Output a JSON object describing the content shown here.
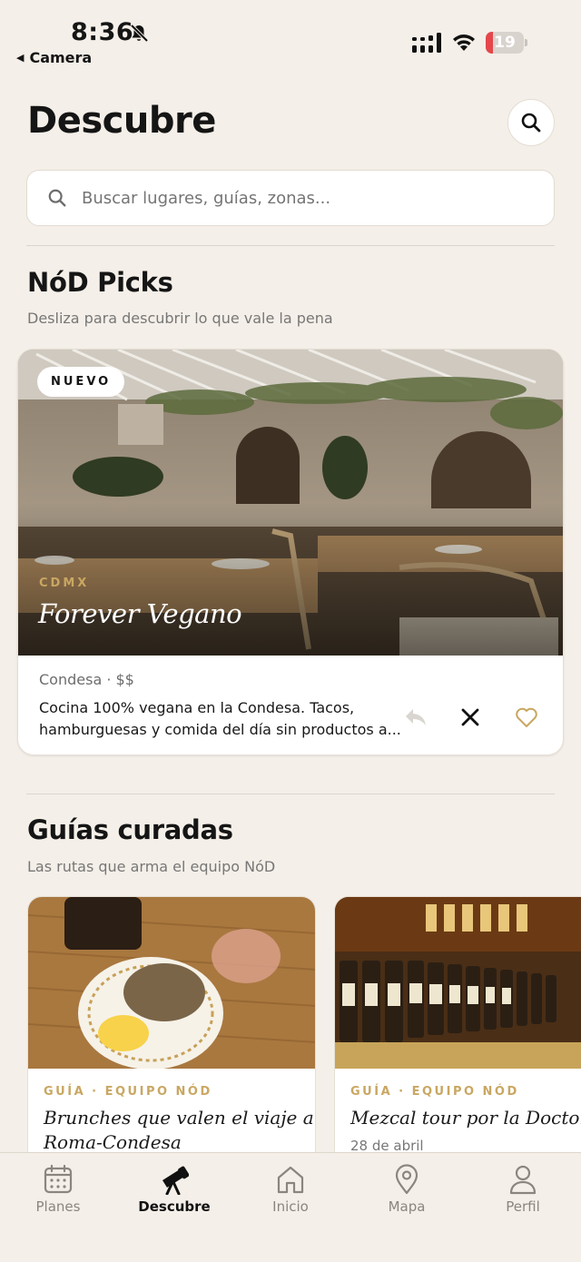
{
  "status": {
    "time": "8:36",
    "back_app": "Camera",
    "battery": "19",
    "battery_level": 0.19
  },
  "header": {
    "title": "Descubre"
  },
  "search": {
    "placeholder": "Buscar lugares, guías, zonas..."
  },
  "picks": {
    "title": "NóD Picks",
    "subtitle": "Desliza para descubrir lo que vale la pena",
    "card": {
      "badge": "NUEVO",
      "city": "CDMX",
      "name": "Forever Vegano",
      "meta": "Condesa · $$",
      "desc_line1": "Cocina 100% vegana en la Condesa. Tacos,",
      "desc_line2": "hamburguesas y comida del día sin productos a..."
    }
  },
  "guides": {
    "title": "Guías curadas",
    "subtitle": "Las rutas que arma el equipo NóD",
    "items": [
      {
        "kicker": "GUÍA · EQUIPO NÓD",
        "title_line1": "Brunches que valen el viaje a",
        "title_line2": "Roma-Condesa",
        "date": ""
      },
      {
        "kicker": "GUÍA · EQUIPO NÓD",
        "title_line1": "Mezcal tour por la Doctores",
        "title_line2": "",
        "date": "28 de abril"
      }
    ]
  },
  "tabs": [
    {
      "label": "Planes",
      "icon": "calendar-icon"
    },
    {
      "label": "Descubre",
      "icon": "telescope-icon",
      "active": true
    },
    {
      "label": "Inicio",
      "icon": "home-icon"
    },
    {
      "label": "Mapa",
      "icon": "map-pin-icon"
    },
    {
      "label": "Perfil",
      "icon": "person-icon"
    }
  ],
  "colors": {
    "background": "#f4efe8",
    "accent_gold": "#c9a762",
    "battery_red": "#e5474b"
  }
}
